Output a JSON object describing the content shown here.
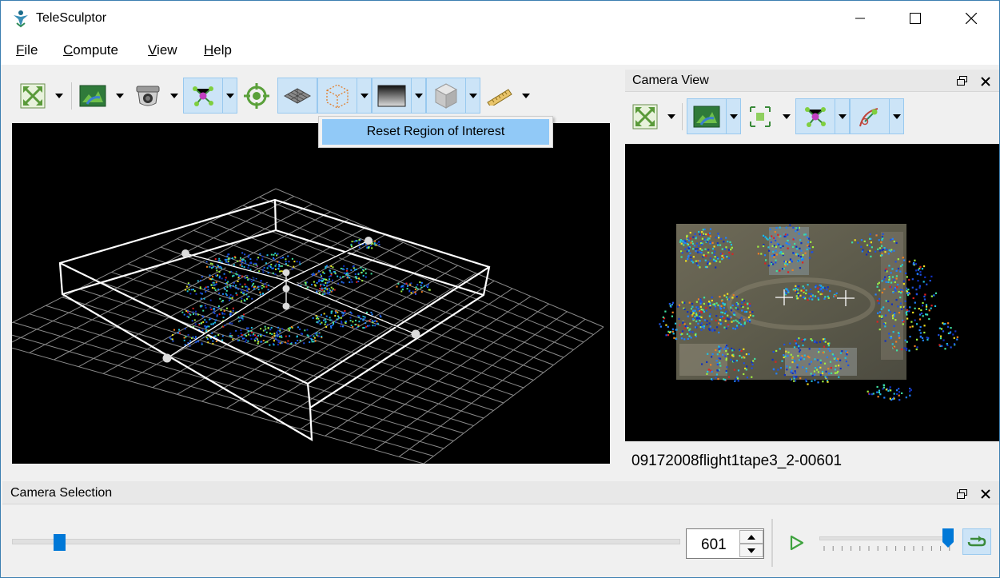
{
  "window": {
    "title": "TeleSculptor"
  },
  "menu": [
    {
      "label": "File",
      "accel": "F",
      "rest": "ile"
    },
    {
      "label": "Compute",
      "accel": "C",
      "rest": "ompute"
    },
    {
      "label": "View",
      "accel": "V",
      "rest": "iew"
    },
    {
      "label": "Help",
      "accel": "H",
      "rest": "elp"
    }
  ],
  "toolbar_main": {
    "icons": [
      "reset-view-icon",
      "image-icon",
      "camera-icon",
      "landmarks-icon",
      "target-icon",
      "ground-plane-icon",
      "roi-box-icon",
      "depth-map-icon",
      "volume-cube-icon",
      "ruler-icon"
    ]
  },
  "roi_menu": {
    "reset_label": "Reset Region of Interest"
  },
  "camera_view": {
    "title": "Camera View",
    "icons": [
      "reset-view-icon",
      "image-icon",
      "feature-tracks-icon",
      "landmarks-icon",
      "residuals-icon"
    ],
    "frame_name": "09172008flight1tape3_2-00601"
  },
  "camera_selection": {
    "title": "Camera Selection",
    "frame_value": "601",
    "slider_fraction": 0.07,
    "speed_fraction": 0.97
  },
  "colors": {
    "accent": "#0078d7",
    "highlight": "#91c9f7",
    "toggle_bg": "#cce4f7"
  }
}
